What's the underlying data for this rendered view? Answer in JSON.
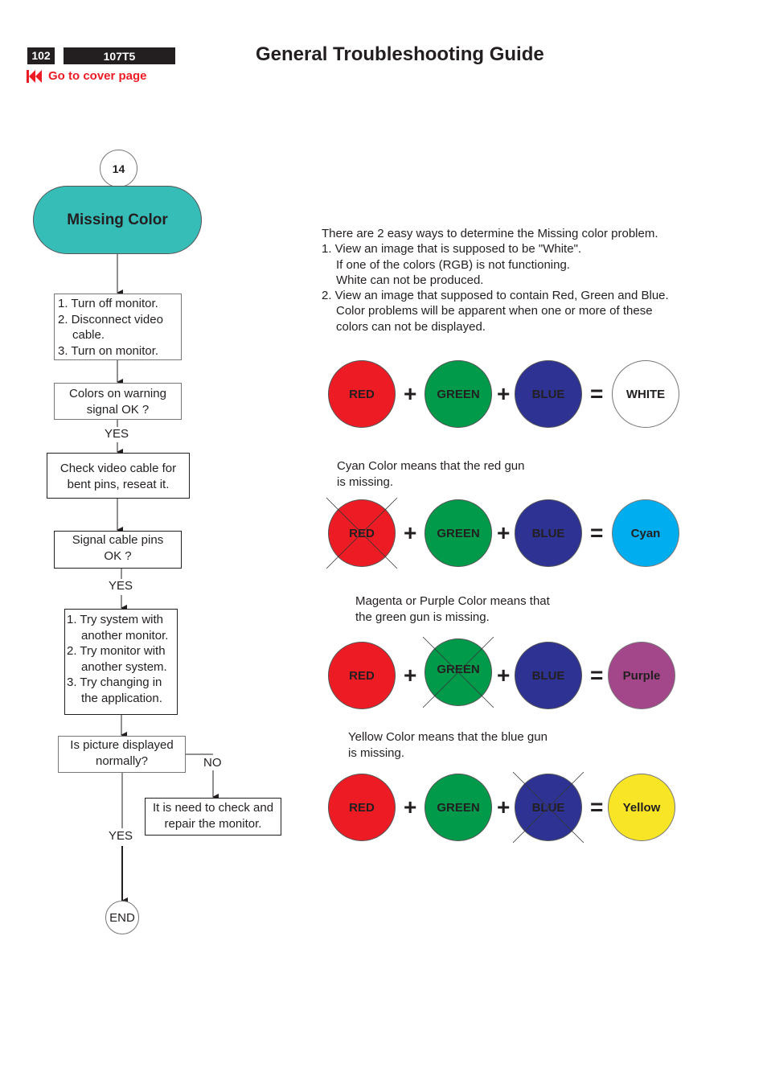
{
  "header": {
    "page_number": "102",
    "model": "107T5",
    "cover_link_label": "Go to cover page",
    "cover_link_icon": "skip-to-start-icon",
    "title": "General Troubleshooting Guide"
  },
  "flowchart": {
    "connector_number": "14",
    "start_label": "Missing Color",
    "steps": {
      "step1": [
        "1. Turn off monitor.",
        "2. Disconnect video cable.",
        "3. Turn on monitor."
      ],
      "decision1": "Colors on warning signal OK ?",
      "yes1": "YES",
      "step2": "Check video cable for bent pins, reseat it.",
      "decision2": "Signal cable pins OK ?",
      "yes2": "YES",
      "step3": [
        "1. Try system with another monitor.",
        "2. Try monitor with another system.",
        "3. Try changing in the application."
      ],
      "decision3": "Is picture displayed normally?",
      "no3": "NO",
      "repair": "It is need to check and repair the monitor.",
      "yes3": "YES",
      "end_label": "END"
    }
  },
  "explanation": {
    "intro": "There are 2 easy ways to determine the Missing color problem.",
    "way1_line1": "1. View an image that is supposed to be \"White\".",
    "way1_line2": "If one of the colors (RGB) is not functioning.",
    "way1_line3": "White can not be produced.",
    "way2_line1": "2. View an image that supposed to contain Red, Green and Blue.",
    "way2_line2": "Color problems will be apparent when one or more of these",
    "way2_line3": "colors can not be displayed."
  },
  "colors": {
    "red": "#ed1c24",
    "green": "#009a4a",
    "blue": "#2e3393",
    "white": "#ffffff",
    "cyan": "#00aeef",
    "purple": "#a3478a",
    "yellow": "#f7e526",
    "teal": "#36bdb7"
  },
  "equations": [
    {
      "caption": [],
      "inputs": [
        "RED",
        "GREEN",
        "BLUE"
      ],
      "crossed": null,
      "plus": "+",
      "equals": "=",
      "result": "WHITE"
    },
    {
      "caption": [
        "Cyan Color means that the red gun",
        "is missing."
      ],
      "inputs": [
        "RED",
        "GREEN",
        "BLUE"
      ],
      "crossed": "RED",
      "plus": "+",
      "equals": "=",
      "result": "Cyan"
    },
    {
      "caption": [
        "Magenta or Purple Color means that",
        "the green gun is missing."
      ],
      "inputs": [
        "RED",
        "GREEN",
        "BLUE"
      ],
      "crossed": "GREEN",
      "plus": "+",
      "equals": "=",
      "result": "Purple"
    },
    {
      "caption": [
        "Yellow Color means that the blue gun",
        "is missing."
      ],
      "inputs": [
        "RED",
        "GREEN",
        "BLUE"
      ],
      "crossed": "BLUE",
      "plus": "+",
      "equals": "=",
      "result": "Yellow"
    }
  ]
}
